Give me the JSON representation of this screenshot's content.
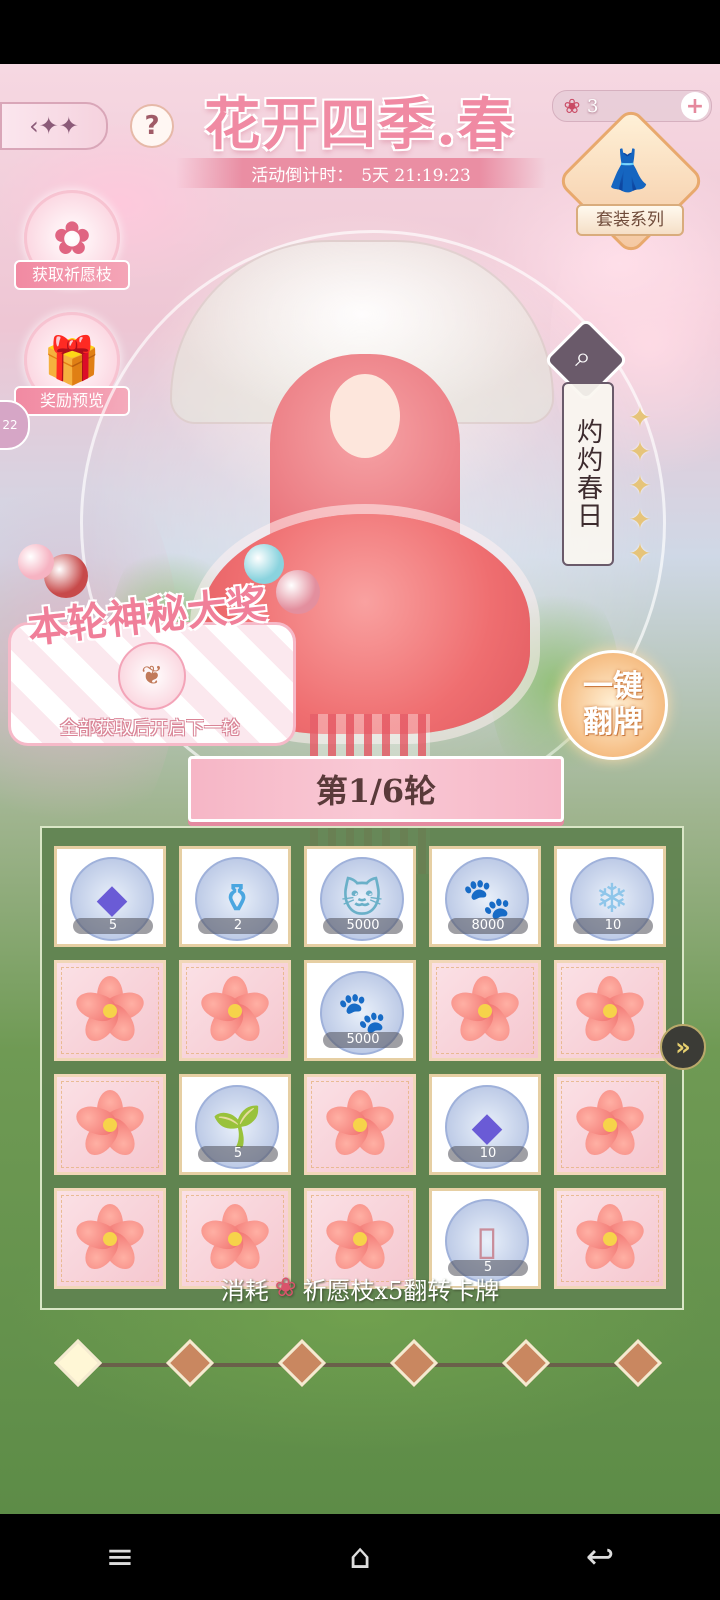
{
  "header": {
    "back_arrow": "‹✦✦",
    "help": "?",
    "event_title": "花开四季.春",
    "countdown_label": "活动倒计时：",
    "countdown_value": "5天 21:19:23",
    "currency_icon": "wish-branch-icon",
    "currency_count": "3",
    "plus": "+"
  },
  "outfit_series": {
    "label": "套装系列",
    "icon": "red-dress-icon"
  },
  "side_buttons": [
    {
      "label": "获取祈愿枝",
      "icon": "rose-icon"
    },
    {
      "label": "奖励预览",
      "icon": "gift-magnifier-icon"
    }
  ],
  "left_tab_text": "22",
  "outfit": {
    "name": "灼灼春日",
    "stars": 5
  },
  "flip_all": {
    "label": "一键翻牌"
  },
  "mystery": {
    "title": "本轮神秘大奖",
    "item_icon": "earrings-icon",
    "note": "全部获取后开启下一轮"
  },
  "round": {
    "label": "第1/6轮",
    "current": 1,
    "total": 6
  },
  "cards": [
    {
      "state": "revealed",
      "icon": "purple-gem-icon",
      "glyph": "◆",
      "color": "#6a5bd6",
      "qty": "5"
    },
    {
      "state": "revealed",
      "icon": "potion-bottle-icon",
      "glyph": "⚱",
      "color": "#4aa6e0",
      "qty": "2"
    },
    {
      "state": "revealed",
      "icon": "cat-figure-icon",
      "glyph": "🐱",
      "color": "#6ab0c8",
      "qty": "5000"
    },
    {
      "state": "revealed",
      "icon": "paw-icon",
      "glyph": "🐾",
      "color": "#f09aa3",
      "qty": "8000"
    },
    {
      "state": "revealed",
      "icon": "crystal-shards-icon",
      "glyph": "❄",
      "color": "#8fc6ea",
      "qty": "10"
    },
    {
      "state": "hidden",
      "icon": "flower-card-back-icon"
    },
    {
      "state": "hidden",
      "icon": "flower-card-back-icon"
    },
    {
      "state": "revealed",
      "icon": "paw-icon",
      "glyph": "🐾",
      "color": "#f09aa3",
      "qty": "5000"
    },
    {
      "state": "hidden",
      "icon": "flower-card-back-icon"
    },
    {
      "state": "hidden",
      "icon": "flower-card-back-icon"
    },
    {
      "state": "hidden",
      "icon": "flower-card-back-icon"
    },
    {
      "state": "revealed",
      "icon": "potted-plant-icon",
      "glyph": "🌱",
      "color": "#5da34a",
      "qty": "5"
    },
    {
      "state": "hidden",
      "icon": "flower-card-back-icon"
    },
    {
      "state": "revealed",
      "icon": "purple-gem-icon",
      "glyph": "◆",
      "color": "#6a5bd6",
      "qty": "10"
    },
    {
      "state": "hidden",
      "icon": "flower-card-back-icon"
    },
    {
      "state": "hidden",
      "icon": "flower-card-back-icon"
    },
    {
      "state": "hidden",
      "icon": "flower-card-back-icon"
    },
    {
      "state": "hidden",
      "icon": "flower-card-back-icon"
    },
    {
      "state": "revealed",
      "icon": "portrait-card-icon",
      "glyph": "▯",
      "color": "#c98d9a",
      "qty": "5"
    },
    {
      "state": "hidden",
      "icon": "flower-card-back-icon"
    }
  ],
  "next_arrow": "»",
  "cost": {
    "prefix": "消耗",
    "icon": "wish-branch-icon",
    "suffix": "祈愿枝x5翻转卡牌"
  },
  "progress": {
    "nodes_done": 1,
    "nodes_total": 6
  },
  "nav": {
    "menu": "≡",
    "home": "⌂",
    "back": "↩"
  }
}
